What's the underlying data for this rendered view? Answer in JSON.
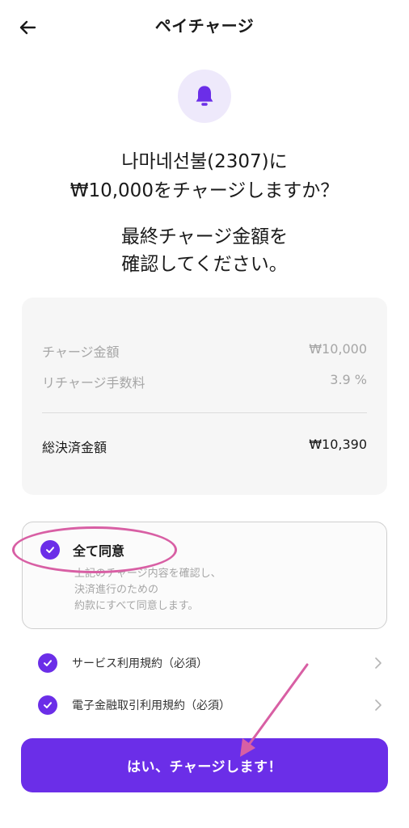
{
  "header": {
    "title": "ペイチャージ",
    "back_icon": "arrow-left-icon"
  },
  "hero": {
    "icon": "bell-icon",
    "question_line1": "나마네선불(2307)に",
    "question_line2": "₩10,000をチャージしますか？",
    "confirm_line1": "最終チャージ金額を",
    "confirm_line2": "確認してください。"
  },
  "summary": {
    "rows": [
      {
        "label": "チャージ金額",
        "value": "₩10,000"
      },
      {
        "label": "リチャージ手数料",
        "value": "3.9 %"
      }
    ],
    "total_label": "総決済金額",
    "total_value": "₩10,390"
  },
  "agreement": {
    "all_label": "全て同意",
    "desc_line1": "上記のチャージ内容を確認し、",
    "desc_line2": "決済進行のための",
    "desc_line3": "約款にすべて同意します。",
    "terms": [
      {
        "label": "サービス利用規約（必須）"
      },
      {
        "label": "電子金融取引利用規約（必須）"
      }
    ]
  },
  "cta": {
    "label": "はい、チャージします！"
  },
  "colors": {
    "accent": "#6b2ee8",
    "accent_light": "#eee9fb",
    "annotation": "#d85fa4",
    "muted_text": "#a6a6a6"
  }
}
